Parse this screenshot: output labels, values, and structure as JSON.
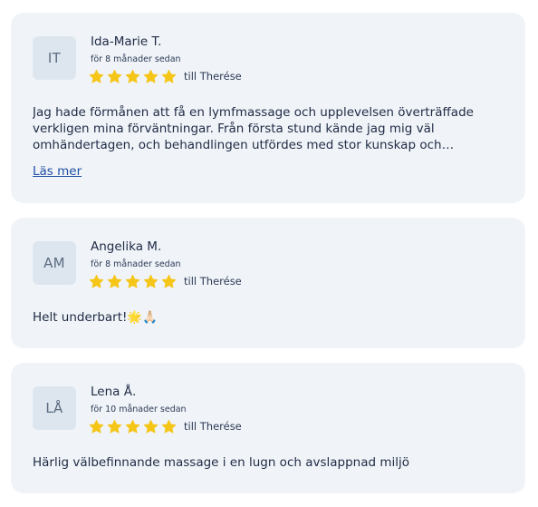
{
  "colors": {
    "card_background": "#f0f4f8",
    "avatar_background": "#dde6ef",
    "star": "#f5c518",
    "link": "#1f4fa3"
  },
  "reviews": [
    {
      "initials": "IT",
      "name": "Ida-Marie T.",
      "date": "för 8 månader sedan",
      "rating": 5,
      "recipient": "till Therése",
      "text": "Jag hade förmånen att få en lymfmassage och upplevelsen överträffade verkligen mina förväntningar. Från första stund kände jag mig väl omhändertagen, och behandlingen utfördes med stor kunskap och varsamhet.",
      "more_label": "Läs mer"
    },
    {
      "initials": "AM",
      "name": "Angelika M.",
      "date": "för 8 månader sedan",
      "rating": 5,
      "recipient": "till Therése",
      "text": "Helt underbart!🌟🙏🏻"
    },
    {
      "initials": "LÅ",
      "name": "Lena Å.",
      "date": "för 10 månader sedan",
      "rating": 5,
      "recipient": "till Therése",
      "text": "Härlig välbefinnande massage i en lugn och avslappnad miljö"
    }
  ]
}
